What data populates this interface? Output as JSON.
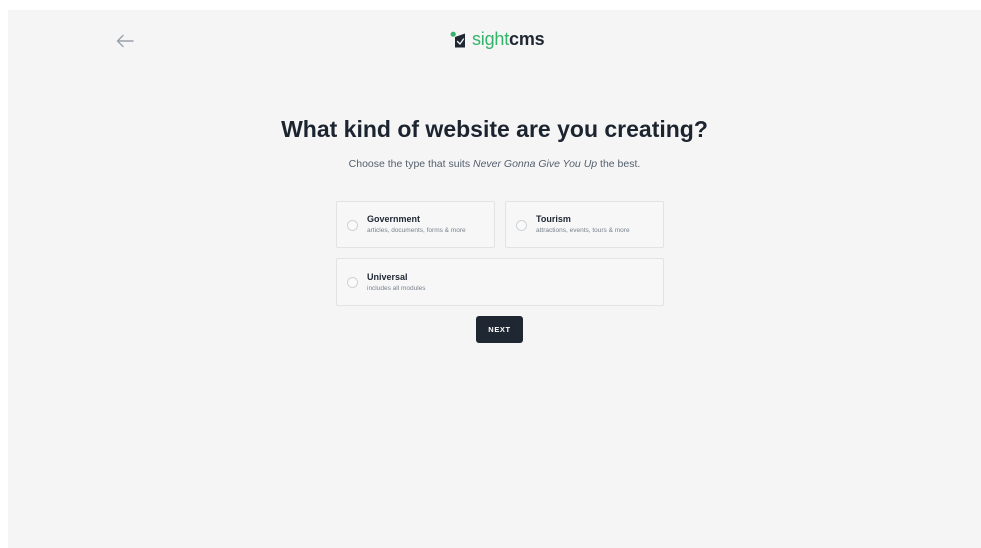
{
  "header": {
    "back_icon": "arrow-left-icon",
    "logo": {
      "icon": "sightcms-logo-icon",
      "part1": "sight",
      "part2": "cms",
      "accent_color": "#34b36b"
    }
  },
  "main": {
    "title": "What kind of website are you creating?",
    "subtitle": {
      "before": "Choose the type that suits ",
      "project_name": "Never Gonna Give You Up",
      "after": " the best."
    },
    "options": [
      {
        "name": "Government",
        "description": "articles, documents, forms & more",
        "selected": false
      },
      {
        "name": "Tourism",
        "description": "attractions, events, tours & more",
        "selected": false
      },
      {
        "name": "Universal",
        "description": "includes all modules",
        "selected": false
      }
    ],
    "next_label": "NEXT",
    "button_color": "#1f2733"
  }
}
